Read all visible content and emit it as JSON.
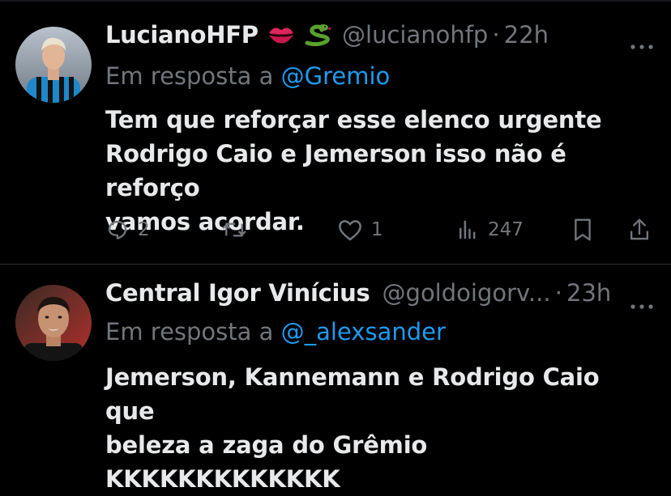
{
  "tweets": [
    {
      "display_name": "LucianoHFP",
      "handle": "@lucianohfp",
      "separator": "·",
      "time": "22h",
      "reply_prefix": "Em resposta a ",
      "reply_to": "@Gremio",
      "text": "Tem que reforçar esse elenco urgente\nRodrigo Caio e Jemerson isso não é reforço\nvamos acordar.",
      "emojis": [
        "kiss-mark-icon",
        "snake-icon"
      ],
      "stats": {
        "replies": "2",
        "retweets": "",
        "likes": "1",
        "views": "247"
      }
    },
    {
      "display_name": "Central Igor Vinícius",
      "handle": "@goldoigorv...",
      "separator": "·",
      "time": "23h",
      "reply_prefix": "Em resposta a ",
      "reply_to": "@_alexsander",
      "text": "Jemerson, Kannemann e Rodrigo Caio que\nbeleza a zaga do Grêmio\nKKKKKKKKKKKKK"
    }
  ],
  "colors": {
    "background": "#000000",
    "text": "#e7e9ea",
    "muted": "#71767b",
    "link": "#1d9bf0",
    "divider": "#2f3336"
  }
}
